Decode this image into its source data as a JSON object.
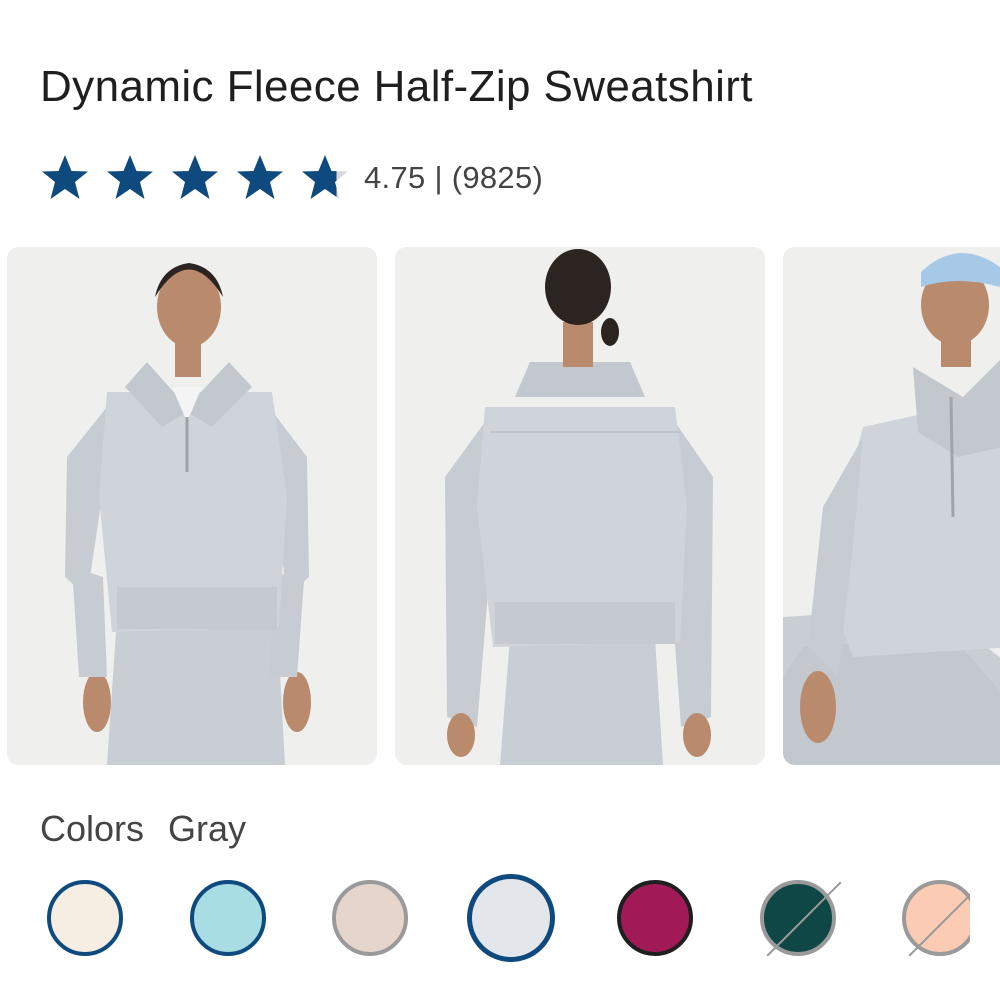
{
  "product": {
    "title": "Dynamic Fleece Half-Zip Sweatshirt"
  },
  "rating": {
    "stars_filled": 4.75,
    "stars_max": 5,
    "star_color": "#0f4a7e",
    "text": "4.75 | (9825)"
  },
  "gallery": {
    "images": [
      {
        "icon": "model-front-photo"
      },
      {
        "icon": "model-back-photo"
      },
      {
        "icon": "model-seated-photo"
      }
    ]
  },
  "colors": {
    "label": "Colors",
    "selected_name": "Gray",
    "swatches": [
      {
        "color": "#f6eee2",
        "available": true,
        "selected": false
      },
      {
        "color": "#a8dde4",
        "available": true,
        "selected": false
      },
      {
        "color": "#e6d5cb",
        "available": true,
        "selected": false
      },
      {
        "color": "#e3e6ea",
        "available": true,
        "selected": true
      },
      {
        "color": "#a11a55",
        "available": true,
        "selected": false
      },
      {
        "color": "#0f4646",
        "available": false,
        "selected": false
      },
      {
        "color": "#fccbb3",
        "available": false,
        "selected": false
      }
    ]
  }
}
